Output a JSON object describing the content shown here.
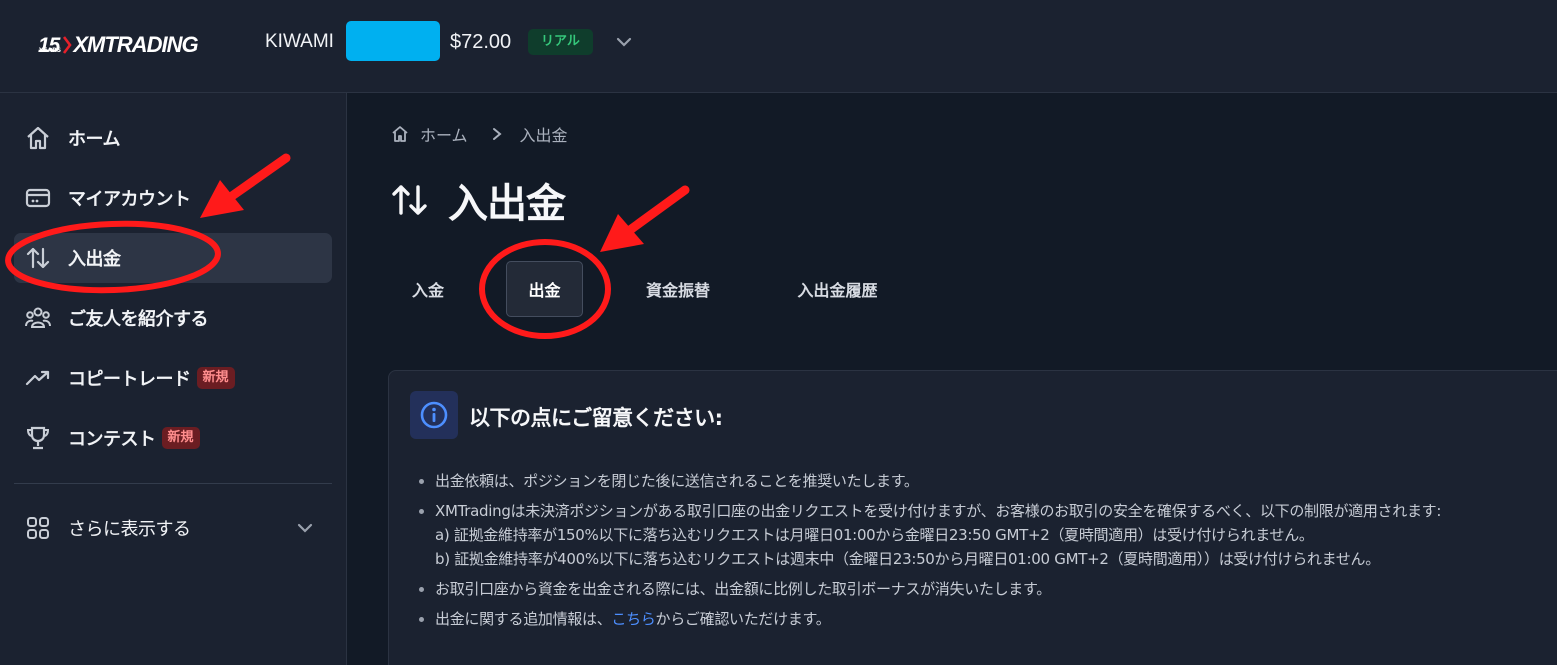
{
  "header": {
    "logo_years": "15",
    "logo_years_sub": "YEARS",
    "logo_brand": "XMTRADING",
    "account_name": "KIWAMI",
    "balance": "$72.00",
    "account_type_badge": "リアル",
    "mask_color": "#00b0f0"
  },
  "sidebar": {
    "items": [
      {
        "label": "ホーム",
        "icon": "home-icon"
      },
      {
        "label": "マイアカウント",
        "icon": "card-icon"
      },
      {
        "label": "入出金",
        "icon": "transfer-arrows-icon",
        "active": true
      },
      {
        "label": "ご友人を紹介する",
        "icon": "people-icon"
      },
      {
        "label": "コピートレード",
        "icon": "trend-up-icon",
        "badge": "新規"
      },
      {
        "label": "コンテスト",
        "icon": "trophy-icon",
        "badge": "新規"
      }
    ],
    "more": {
      "label": "さらに表示する",
      "icon": "grid-icon"
    }
  },
  "breadcrumb": {
    "home": "ホーム",
    "current": "入出金"
  },
  "page": {
    "title": "入出金"
  },
  "tabs": [
    {
      "label": "入金"
    },
    {
      "label": "出金",
      "active": true
    },
    {
      "label": "資金振替"
    },
    {
      "label": "入出金履歴"
    }
  ],
  "notice": {
    "title": "以下の点にご留意ください:",
    "items": [
      "出金依頼は、ポジションを閉じた後に送信されることを推奨いたします。",
      "XMTradingは未決済ポジションがある取引口座の出金リクエストを受け付けますが、お客様のお取引の安全を確保するべく、以下の制限が適用されます:",
      "お取引口座から資金を出金される際には、出金額に比例した取引ボーナスが消失いたします。"
    ],
    "sub_items": [
      "a) 証拠金維持率が150%以下に落ち込むリクエストは月曜日01:00から金曜日23:50 GMT+2（夏時間適用）は受け付けられません。",
      "b) 証拠金維持率が400%以下に落ち込むリクエストは週末中（金曜日23:50から月曜日01:00 GMT+2（夏時間適用））は受け付けられません。"
    ],
    "last_prefix": "出金に関する追加情報は、",
    "last_link": "こちら",
    "last_suffix": "からご確認いただけます。"
  },
  "colors": {
    "accent_link": "#4d8fff",
    "annotation_red": "#ff1a1a",
    "badge_real_bg": "#0f3d2c",
    "badge_real_text": "#35c77b",
    "badge_new_bg": "#6b1d22"
  }
}
